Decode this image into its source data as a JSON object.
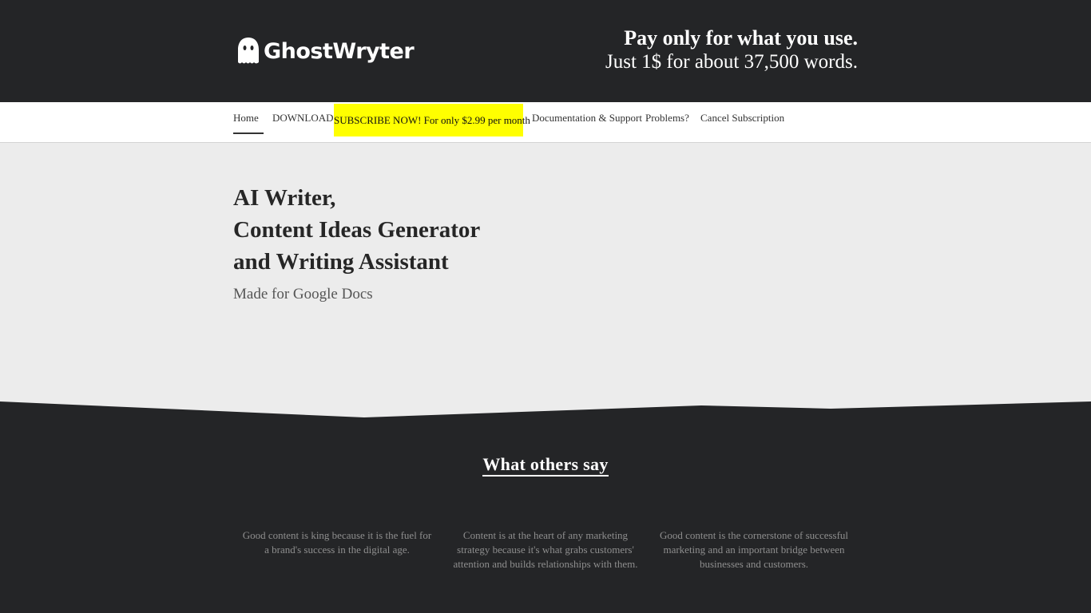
{
  "brand": {
    "name": "GhostWryter",
    "logo_icon": "ghost-icon"
  },
  "tagline": {
    "line1": "Pay only for what you use.",
    "line2": "Just 1$ for about 37,500 words."
  },
  "nav": {
    "home": "Home",
    "download": "DOWNLOAD",
    "subscribe": "SUBSCRIBE NOW! For only $2.99 per month",
    "docs": "Documentation & Support",
    "problems": "Problems?",
    "cancel": "Cancel Subscription"
  },
  "hero": {
    "line1": "AI Writer,",
    "line2": "Content Ideas Generator",
    "line3": "and Writing Assistant",
    "subtitle": "Made for Google Docs"
  },
  "testimonials": {
    "title": "What others say",
    "quotes": [
      "Good content is king because it is the fuel for a brand's success in the digital age.",
      "Content is at the heart of any marketing strategy because it's what grabs customers' attention and builds relationships with them.",
      "Good content is the cornerstone of successful marketing and an important bridge between businesses and customers."
    ]
  },
  "colors": {
    "dark": "#242527",
    "light": "#ececec",
    "accent": "#ffff00"
  }
}
